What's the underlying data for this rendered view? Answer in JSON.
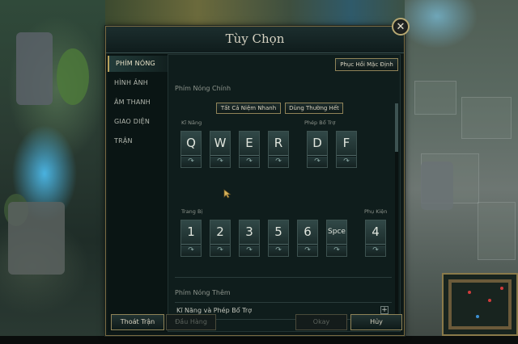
{
  "panel": {
    "title": "Tùy Chọn",
    "restore_defaults_label": "Phục Hồi Mặc Định"
  },
  "sidebar": {
    "items": [
      {
        "label": "PHÍM NÓNG",
        "active": true
      },
      {
        "label": "HÌNH ẢNH",
        "active": false
      },
      {
        "label": "ÂM THANH",
        "active": false
      },
      {
        "label": "GIAO DIỆN",
        "active": false
      },
      {
        "label": "TRẬN",
        "active": false
      }
    ]
  },
  "hotkeys": {
    "main_section_label": "Phím Nóng Chính",
    "quickcast_all_label": "Tất Cả Niệm Nhanh",
    "normal_cast_label": "Dùng Thường Hết",
    "abilities_label": "Kĩ Năng",
    "summoners_label": "Phép Bổ Trợ",
    "items_label": "Trang Bị",
    "trinket_label": "Phụ Kiện",
    "ability_keys": [
      "Q",
      "W",
      "E",
      "R"
    ],
    "summoner_keys": [
      "D",
      "F"
    ],
    "item_keys": [
      "1",
      "2",
      "3",
      "5",
      "6",
      "Spce"
    ],
    "trinket_keys": [
      "4"
    ],
    "modifier_glyph": "↷",
    "extra_section_label": "Phím Nóng Thêm",
    "extra_row_label": "Kĩ Năng và Phép Bổ Trợ",
    "expand_glyph": "+"
  },
  "footer": {
    "exit_match_label": "Thoát Trận",
    "surrender_label": "Đầu Hàng",
    "okay_label": "Okay",
    "cancel_label": "Hủy"
  },
  "close_glyph": "✕",
  "colors": {
    "accent_gold": "#b8a25c",
    "panel_bg": "#0d1817",
    "text_light": "#d8d3c0"
  }
}
